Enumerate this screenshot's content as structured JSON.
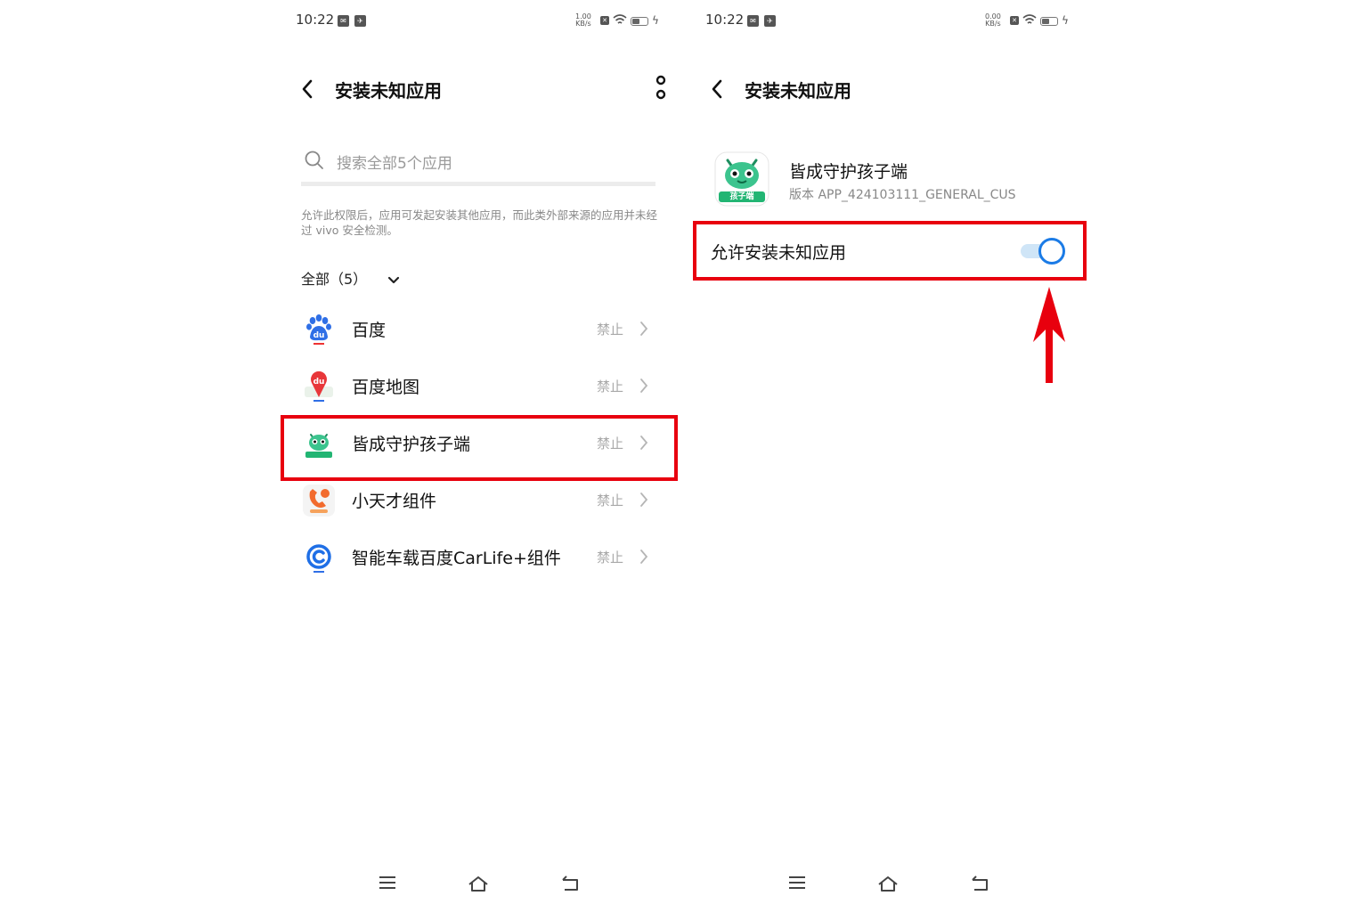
{
  "left": {
    "status": {
      "time": "10:22",
      "netspeed_value": "1.00",
      "netspeed_unit": "KB/s"
    },
    "title": "安装未知应用",
    "search": {
      "placeholder": "搜索全部5个应用"
    },
    "hint": "允许此权限后，应用可发起安装其他应用，而此类外部来源的应用并未经过 vivo 安全检测。",
    "filter": {
      "label": "全部（5）"
    },
    "apps": [
      {
        "name": "百度",
        "state": "禁止",
        "icon": "baidu-icon"
      },
      {
        "name": "百度地图",
        "state": "禁止",
        "icon": "baidu-map-icon"
      },
      {
        "name": "皆成守护孩子端",
        "state": "禁止",
        "icon": "child-guard-icon",
        "highlighted": true
      },
      {
        "name": "小天才组件",
        "state": "禁止",
        "icon": "xiaotiancai-icon"
      },
      {
        "name": "智能车载百度CarLife+组件",
        "state": "禁止",
        "icon": "carlife-icon"
      }
    ]
  },
  "right": {
    "status": {
      "time": "10:22",
      "netspeed_value": "0.00",
      "netspeed_unit": "KB/s"
    },
    "title": "安装未知应用",
    "app": {
      "name": "皆成守护孩子端",
      "version": "版本 APP_424103111_GENERAL_CUS",
      "icon_caption": "孩子端"
    },
    "permission": {
      "label": "允许安装未知应用",
      "enabled": true
    }
  },
  "colors": {
    "highlight": "#e8000e",
    "accent": "#1b7be6",
    "brand_green": "#2dbf87"
  }
}
